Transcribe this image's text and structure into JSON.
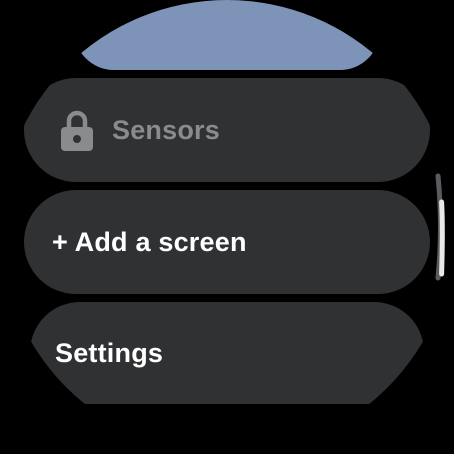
{
  "screens": {
    "items": [
      {
        "label": "Sensors",
        "icon": "lock-icon",
        "locked": true
      },
      {
        "label": "+ Add a screen"
      },
      {
        "label": "Settings"
      }
    ]
  },
  "colors": {
    "background": "#000000",
    "card": "#303133",
    "top_card": "#7d93b8",
    "text": "#ffffff",
    "text_disabled": "#8a8b8d",
    "scroll_track": "#5a5b5e",
    "scroll_thumb": "#e8e8e8"
  },
  "scroll": {
    "position": 0.5
  }
}
